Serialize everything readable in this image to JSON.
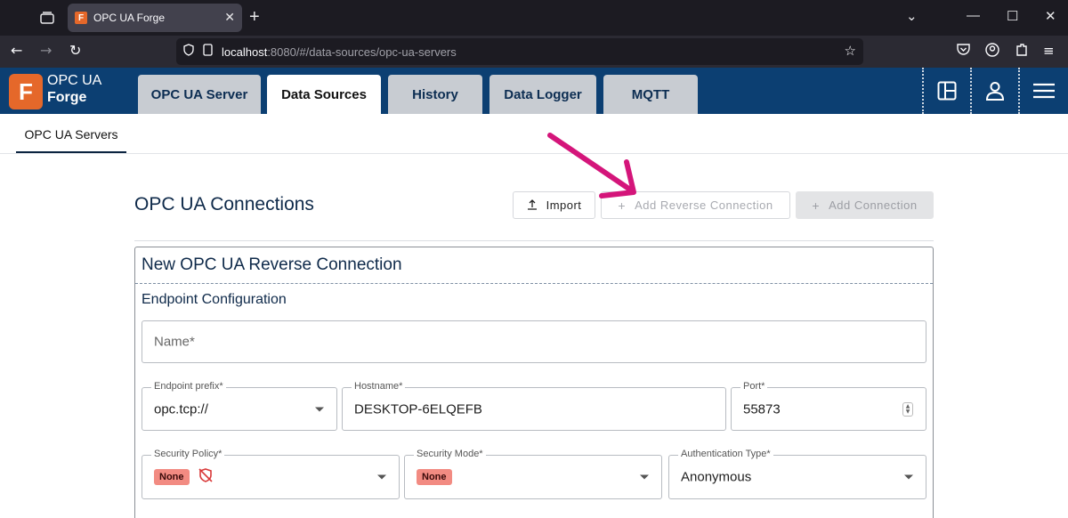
{
  "browser": {
    "tab_title": "OPC UA Forge",
    "tab_favicon_letter": "F",
    "new_tab": "+",
    "url_host": "localhost",
    "url_path": ":8080/#/data-sources/opc-ua-servers"
  },
  "header": {
    "logo_letter": "F",
    "logo_line1": "OPC UA",
    "logo_line2": "Forge",
    "tabs": [
      {
        "label": "OPC UA Server"
      },
      {
        "label": "Data Sources"
      },
      {
        "label": "History"
      },
      {
        "label": "Data Logger"
      },
      {
        "label": "MQTT"
      }
    ]
  },
  "subnav": {
    "active": "OPC UA Servers"
  },
  "section": {
    "title": "OPC UA Connections",
    "import_label": "Import",
    "reverse_label": "Add Reverse Connection",
    "add_label": "Add Connection"
  },
  "form": {
    "title": "New OPC UA Reverse Connection",
    "group_label": "Endpoint Configuration",
    "name_placeholder": "Name*",
    "endpoint_prefix": {
      "label": "Endpoint prefix*",
      "value": "opc.tcp://"
    },
    "hostname": {
      "label": "Hostname*",
      "value": "DESKTOP-6ELQEFB"
    },
    "port": {
      "label": "Port*",
      "value": "55873"
    },
    "security_policy": {
      "label": "Security Policy*",
      "value": "None"
    },
    "security_mode": {
      "label": "Security Mode*",
      "value": "None"
    },
    "auth_type": {
      "label": "Authentication Type*",
      "value": "Anonymous"
    }
  },
  "colors": {
    "header_bg": "#0c3f72",
    "logo_orange": "#e5682a",
    "badge_red": "#f28b82",
    "arrow": "#d4157a"
  }
}
